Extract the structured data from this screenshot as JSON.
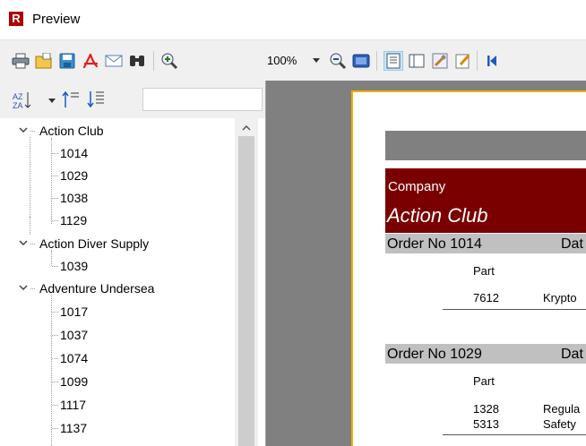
{
  "window": {
    "title": "Preview",
    "icon": "report-app-icon",
    "icon_letter": "R"
  },
  "toolbar": {
    "zoom": "100%",
    "buttons": [
      "print-icon",
      "open-icon",
      "save-icon",
      "pdf-icon",
      "email-icon",
      "find-icon",
      "zoom-in-icon",
      "zoom-out-icon",
      "page-icon",
      "outline-icon",
      "thumbnails-icon",
      "settings-icon",
      "edit-icon",
      "first-page-icon"
    ]
  },
  "sidebar": {
    "tree": [
      {
        "label": "Action Club",
        "children": [
          "1014",
          "1029",
          "1038",
          "1129"
        ]
      },
      {
        "label": "Action Diver Supply",
        "children": [
          "1039"
        ]
      },
      {
        "label": "Adventure Undersea",
        "children": [
          "1017",
          "1037",
          "1074",
          "1099",
          "1117",
          "1137"
        ]
      }
    ]
  },
  "report": {
    "company_label": "Company",
    "company_name": "Action Club",
    "orders": [
      {
        "header": "Order No 1014",
        "date_label": "Dat",
        "part_label": "Part",
        "lines": [
          {
            "part": "7612",
            "desc": "Krypto"
          }
        ]
      },
      {
        "header": "Order No 1029",
        "date_label": "Dat",
        "part_label": "Part",
        "lines": [
          {
            "part": "1328",
            "desc": "Regula"
          },
          {
            "part": "5313",
            "desc": "Safety"
          }
        ]
      }
    ]
  },
  "colors": {
    "company_band": "#7a0000",
    "order_band": "#c0c0c0",
    "page_border": "#f0b000",
    "preview_bg": "#808080"
  }
}
